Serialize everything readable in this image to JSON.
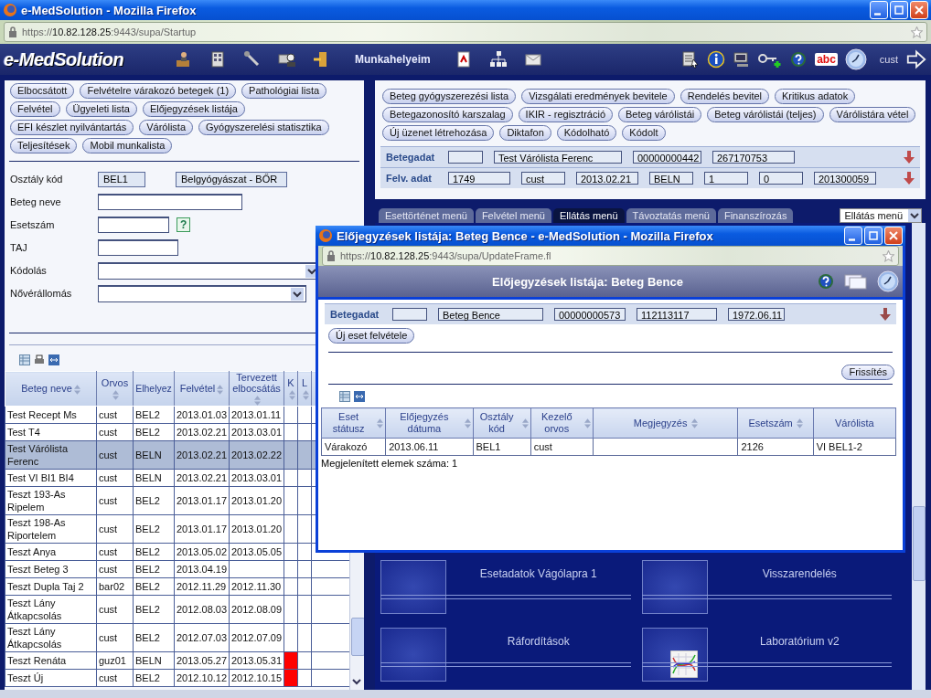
{
  "window": {
    "title": "e-MedSolution - Mozilla Firefox",
    "url": {
      "scheme": "https://",
      "host": "10.82.128.25",
      "path": ":9443/supa/Startup"
    }
  },
  "toolbar": {
    "logo": "e-MedSolution",
    "workplace": "Munkahelyeim",
    "spellcheck": "abc",
    "user": "cust"
  },
  "left": {
    "buttons": [
      "Elbocsátott",
      "Felvételre várakozó betegek (1)",
      "Pathológiai lista",
      "Felvétel",
      "Ügyeleti lista",
      "Előjegyzések listája",
      "EFI készlet nyilvántartás",
      "Várólista",
      "Gyógyszerelési statisztika",
      "Teljesítések",
      "Mobil munkalista"
    ],
    "form": [
      {
        "label": "Osztály kód",
        "kind": "code",
        "value": "BEL1",
        "extra": "Belgyógyászat - BŐR"
      },
      {
        "label": "Beteg neve",
        "kind": "text"
      },
      {
        "label": "Esetszám",
        "kind": "help",
        "help": "?"
      },
      {
        "label": "TAJ",
        "kind": "short"
      },
      {
        "label": "Kódolás",
        "kind": "select"
      },
      {
        "label": "Nővérállomás",
        "kind": "select"
      }
    ],
    "table": {
      "columns": [
        {
          "label": "Beteg neve",
          "sortable": true
        },
        {
          "label": "Orvos",
          "sortable": true
        },
        {
          "label": "Elhelyez",
          "sortable": false
        },
        {
          "label": "Felvétel",
          "sortable": true
        },
        {
          "label": "Tervezett elbocsátás",
          "sortable": true
        },
        {
          "label": "K",
          "sortable": true
        },
        {
          "label": "L",
          "sortable": true
        }
      ],
      "rows": [
        {
          "name": "Test Recept Ms",
          "doctor": "cust",
          "place": "BEL2",
          "admitted": "2013.01.03",
          "planned": "2013.01.11",
          "flag": false,
          "selected": false
        },
        {
          "name": "Test T4",
          "doctor": "cust",
          "place": "BEL2",
          "admitted": "2013.02.21",
          "planned": "2013.03.01",
          "flag": false,
          "selected": false
        },
        {
          "name": "Test Várólista Ferenc",
          "doctor": "cust",
          "place": "BELN",
          "admitted": "2013.02.21",
          "planned": "2013.02.22",
          "flag": false,
          "selected": true
        },
        {
          "name": "Test VI BI1 BI4",
          "doctor": "cust",
          "place": "BELN",
          "admitted": "2013.02.21",
          "planned": "2013.03.01",
          "flag": false,
          "selected": false
        },
        {
          "name": "Teszt 193-As Ripelem",
          "doctor": "cust",
          "place": "BEL2",
          "admitted": "2013.01.17",
          "planned": "2013.01.20",
          "flag": false,
          "selected": false
        },
        {
          "name": "Teszt 198-As Riportelem",
          "doctor": "cust",
          "place": "BEL2",
          "admitted": "2013.01.17",
          "planned": "2013.01.20",
          "flag": false,
          "selected": false
        },
        {
          "name": "Teszt Anya",
          "doctor": "cust",
          "place": "BEL2",
          "admitted": "2013.05.02",
          "planned": "2013.05.05",
          "flag": false,
          "selected": false
        },
        {
          "name": "Teszt Beteg 3",
          "doctor": "cust",
          "place": "BEL2",
          "admitted": "2013.04.19",
          "flag": false,
          "selected": false
        },
        {
          "name": "Teszt Dupla Taj 2",
          "doctor": "bar02",
          "place": "BEL2",
          "admitted": "2012.11.29",
          "planned": "2012.11.30",
          "flag": false,
          "selected": false
        },
        {
          "name": "Teszt Lány Átkapcsolás",
          "doctor": "cust",
          "place": "BEL2",
          "admitted": "2012.08.03",
          "planned": "2012.08.09",
          "flag": false,
          "selected": false
        },
        {
          "name": "Teszt Lány Átkapcsolás",
          "doctor": "cust",
          "place": "BEL2",
          "admitted": "2012.07.03",
          "planned": "2012.07.09",
          "flag": false,
          "selected": false
        },
        {
          "name": "Teszt Renáta",
          "doctor": "guz01",
          "place": "BELN",
          "admitted": "2013.05.27",
          "planned": "2013.05.31",
          "flag": true,
          "selected": false
        },
        {
          "name": "Teszt Új",
          "doctor": "cust",
          "place": "BEL2",
          "admitted": "2012.10.12",
          "planned": "2012.10.15",
          "flag": true,
          "selected": false
        }
      ]
    }
  },
  "right": {
    "buttons": [
      "Beteg gyógyszerezési lista",
      "Vizsgálati eredmények bevitele",
      "Rendelés bevitel",
      "Kritikus adatok",
      "Betegazonosító karszalag",
      "IKIR - regisztráció",
      "Beteg várólistái",
      "Beteg várólistái (teljes)",
      "Várólistára vétel",
      "Új üzenet létrehozása",
      "Diktafon",
      "Kódolható",
      "Kódolt"
    ],
    "data_rows": [
      {
        "label": "Betegadat",
        "fields": [
          {
            "kind": "blank"
          },
          {
            "kind": "text",
            "value": "Test Várólista Ferenc"
          },
          {
            "kind": "text",
            "value": "00000000442"
          },
          {
            "kind": "text",
            "value": "267170753"
          }
        ]
      },
      {
        "label": "Felv. adat",
        "fields": [
          {
            "kind": "text",
            "value": "1749"
          },
          {
            "kind": "text",
            "value": "cust"
          },
          {
            "kind": "text",
            "value": "2013.02.21"
          },
          {
            "kind": "text",
            "value": "BELN"
          },
          {
            "kind": "text",
            "value": "1"
          },
          {
            "kind": "text",
            "value": "0"
          },
          {
            "kind": "text",
            "value": "201300059"
          }
        ]
      }
    ],
    "tabs": [
      {
        "label": "Esettörténet menü",
        "selected": false
      },
      {
        "label": "Felvétel menü",
        "selected": false
      },
      {
        "label": "Ellátás menü",
        "selected": true
      },
      {
        "label": "Távoztatás menü",
        "selected": false
      },
      {
        "label": "Finanszírozás",
        "selected": false
      }
    ],
    "menu_select": "Ellátás menü",
    "tiles": [
      {
        "label": "Esetadatok Vágólapra 1",
        "kind": "plain"
      },
      {
        "label": "Visszarendelés",
        "kind": "plain"
      },
      {
        "label": "Ráfordítások",
        "kind": "plain"
      },
      {
        "label": "Laboratórium v2",
        "kind": "chart"
      }
    ]
  },
  "popup": {
    "title": "Előjegyzések listája: Beteg Bence - e-MedSolution - Mozilla Firefox",
    "url": {
      "scheme": "https://",
      "host": "10.82.128.25",
      "path": ":9443/supa/UpdateFrame.fl"
    },
    "header": "Előjegyzések listája: Beteg Bence",
    "patient": {
      "label": "Betegadat",
      "fields": [
        {
          "kind": "blank"
        },
        {
          "kind": "text",
          "value": "Beteg Bence"
        },
        {
          "kind": "text",
          "value": "00000000573"
        },
        {
          "kind": "text",
          "value": "112113117"
        },
        {
          "kind": "text",
          "value": "1972.06.11"
        }
      ]
    },
    "new_button": "Új eset felvétele",
    "refresh_button": "Frissítés",
    "table": {
      "columns": [
        {
          "label": "Eset státusz",
          "sortable": true
        },
        {
          "label": "Előjegyzés dátuma",
          "sortable": true
        },
        {
          "label": "Osztály kód",
          "sortable": true
        },
        {
          "label": "Kezelő orvos",
          "sortable": true
        },
        {
          "label": "Megjegyzés",
          "sortable": true
        },
        {
          "label": "Esetszám",
          "sortable": true
        },
        {
          "label": "Várólista",
          "sortable": false
        }
      ],
      "rows": [
        {
          "cells": [
            "Várakozó",
            "2013.06.11",
            "BEL1",
            "cust",
            null,
            "2126",
            "VI BEL1-2"
          ]
        }
      ]
    },
    "count": "Megjelenített elemek száma: 1"
  }
}
